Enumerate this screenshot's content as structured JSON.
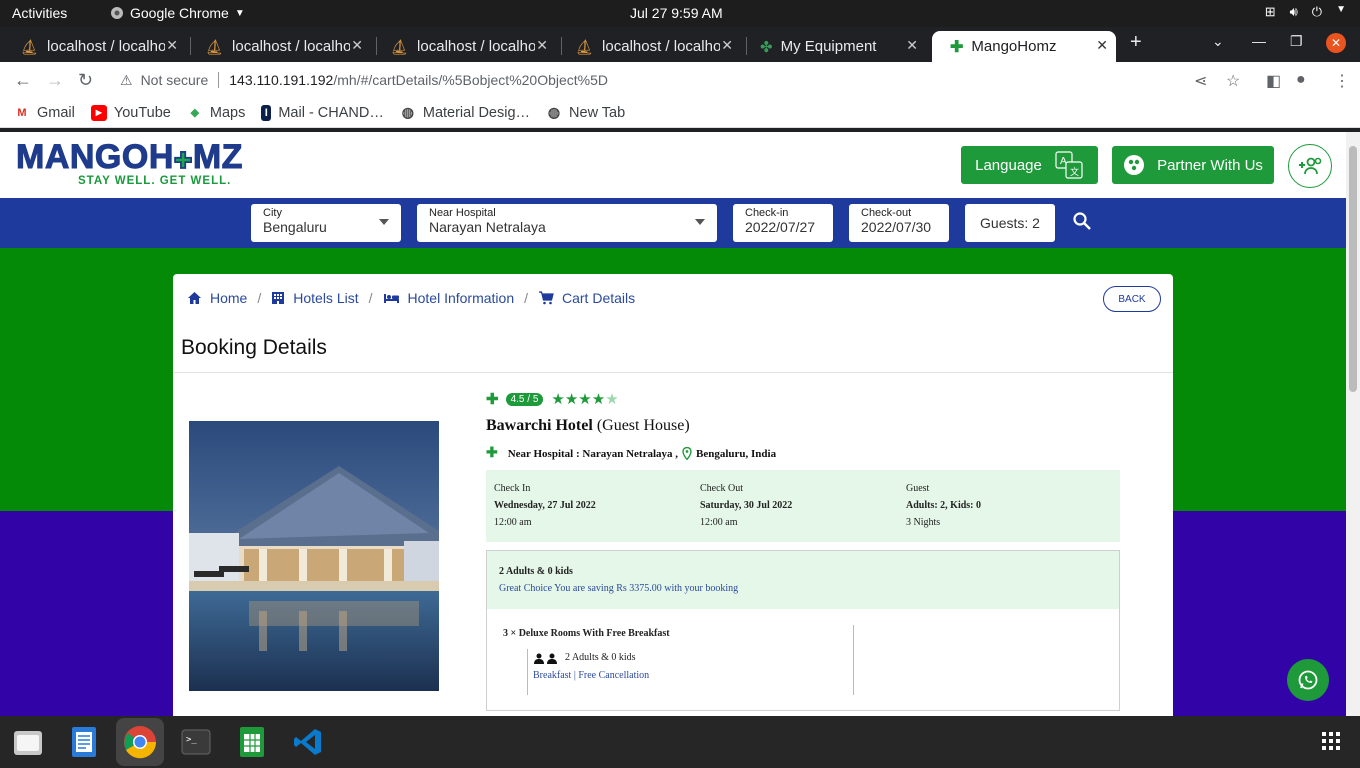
{
  "system": {
    "activities": "Activities",
    "app_name": "Google Chrome",
    "clock": "Jul 27   9:59 AM"
  },
  "tabs": [
    {
      "label": "localhost / localhost",
      "icon": "database-icon",
      "active": false
    },
    {
      "label": "localhost / localhost",
      "icon": "database-icon",
      "active": false
    },
    {
      "label": "localhost / localhost",
      "icon": "database-icon",
      "active": false
    },
    {
      "label": "localhost / localhost",
      "icon": "database-icon",
      "active": false
    },
    {
      "label": "My Equipment",
      "icon": "equipment-icon",
      "active": false
    },
    {
      "label": "MangoHomz",
      "icon": "mangohomz-cross-icon",
      "active": true
    }
  ],
  "omnibox": {
    "security": "Not secure",
    "host": "143.110.191.192",
    "path": "/mh/#/cartDetails/%5Bobject%20Object%5D"
  },
  "bookmarks": [
    {
      "label": "Gmail",
      "icon": "gmail-icon"
    },
    {
      "label": "YouTube",
      "icon": "youtube-icon"
    },
    {
      "label": "Maps",
      "icon": "maps-icon"
    },
    {
      "label": "Mail - CHAND…",
      "icon": "mail-icon"
    },
    {
      "label": "Material Desig…",
      "icon": "globe-icon"
    },
    {
      "label": "New Tab",
      "icon": "globe-icon"
    }
  ],
  "site": {
    "logo_text_a": "MANGO",
    "logo_text_b": "H",
    "logo_text_c": "MZ",
    "tagline": "STAY WELL. GET WELL.",
    "language_btn": "Language",
    "partner_btn": "Partner With Us"
  },
  "search": {
    "city_label": "City",
    "city_value": "Bengaluru",
    "hospital_label": "Near Hospital",
    "hospital_value": "Narayan Netralaya",
    "checkin_label": "Check-in",
    "checkin_value": "2022/07/27",
    "checkout_label": "Check-out",
    "checkout_value": "2022/07/30",
    "guests": "Guests: 2"
  },
  "breadcrumb": {
    "home": "Home",
    "hotels": "Hotels List",
    "info": "Hotel Information",
    "cart": "Cart Details",
    "back": "BACK"
  },
  "booking": {
    "title": "Booking Details",
    "rating": "4.5 / 5",
    "stars_filled": 4,
    "stars_total": 5,
    "hotel_name": "Bawarchi Hotel",
    "hotel_type": "(Guest House)",
    "near_hospital": "Near Hospital : Narayan Netralaya ,",
    "location": "Bengaluru, India",
    "checkin_head": "Check In",
    "checkin_date": "Wednesday, 27 Jul 2022",
    "checkin_time": "12:00 am",
    "checkout_head": "Check Out",
    "checkout_date": "Saturday, 30 Jul 2022",
    "checkout_time": "12:00 am",
    "guest_head": "Guest",
    "guest_summary": "Adults: 2, Kids: 0",
    "nights": "3 Nights",
    "room_summary": "2 Adults & 0 kids",
    "savings": "Great Choice You are saving Rs 3375.00 with your booking",
    "room_line": "3 × Deluxe Rooms With Free Breakfast",
    "room_occupancy": "2 Adults & 0 kids",
    "room_perks": "Breakfast | Free Cancellation"
  },
  "colors": {
    "brand_blue": "#1e3a9c",
    "brand_green": "#1e9a3a",
    "band_green": "#058a07",
    "band_purple": "#3204a8"
  }
}
